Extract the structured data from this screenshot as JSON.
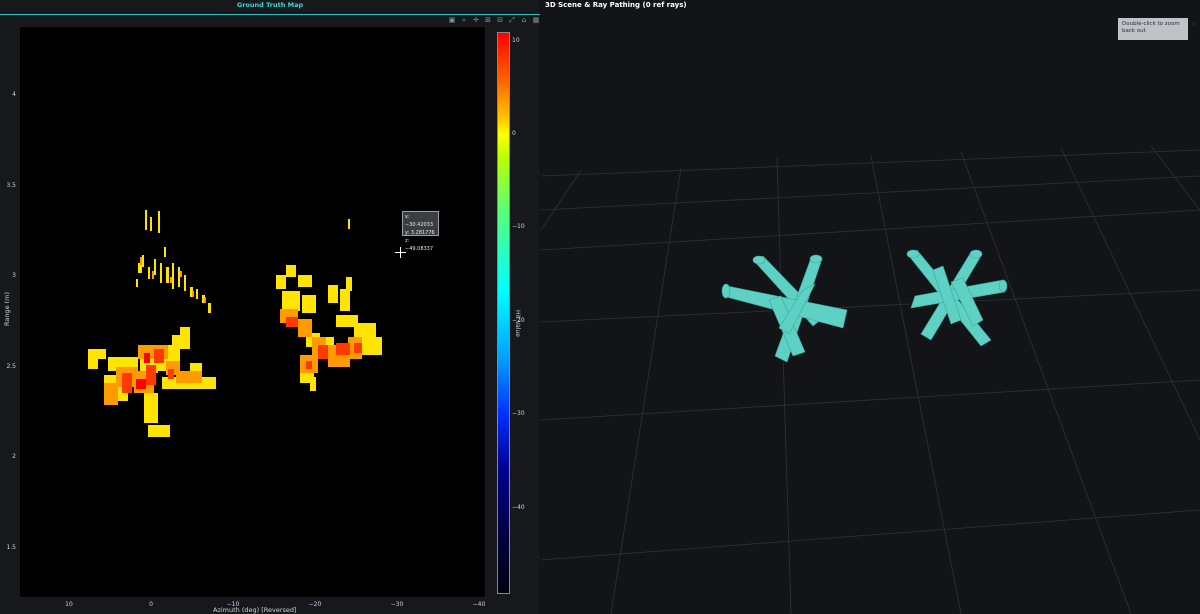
{
  "left_panel": {
    "title": "Ground Truth Map",
    "modebar_icons": [
      "camera-icon",
      "zoom-icon",
      "pan-icon",
      "zoom-in-icon",
      "zoom-out-icon",
      "autoscale-icon",
      "reset-icon",
      "plotly-logo-icon"
    ],
    "y_axis_label": "Range (m)",
    "x_axis_label": "Azimuth (deg) [Reversed]",
    "y_ticks": [
      "4",
      "3.5",
      "3",
      "2.5",
      "2",
      "1.5"
    ],
    "x_ticks": [
      "10",
      "0",
      "−10",
      "−20",
      "−30",
      "−40"
    ],
    "colorbar_title": "Hit Value",
    "colorbar_ticks": [
      "10",
      "0",
      "−10",
      "−20",
      "−30",
      "−40"
    ],
    "tooltip": {
      "x": "x: −30.42033",
      "y": "y: 3.281776",
      "z": "z: −49.08337"
    }
  },
  "right_panel": {
    "title": "3D Scene & Ray Pathing (0 ref rays)",
    "zoom_tip": "Double-click to zoom back out",
    "close": "×"
  },
  "colors": {
    "accent": "#3fd6d6",
    "object": "#5fd1c4",
    "background": "#101114"
  }
}
